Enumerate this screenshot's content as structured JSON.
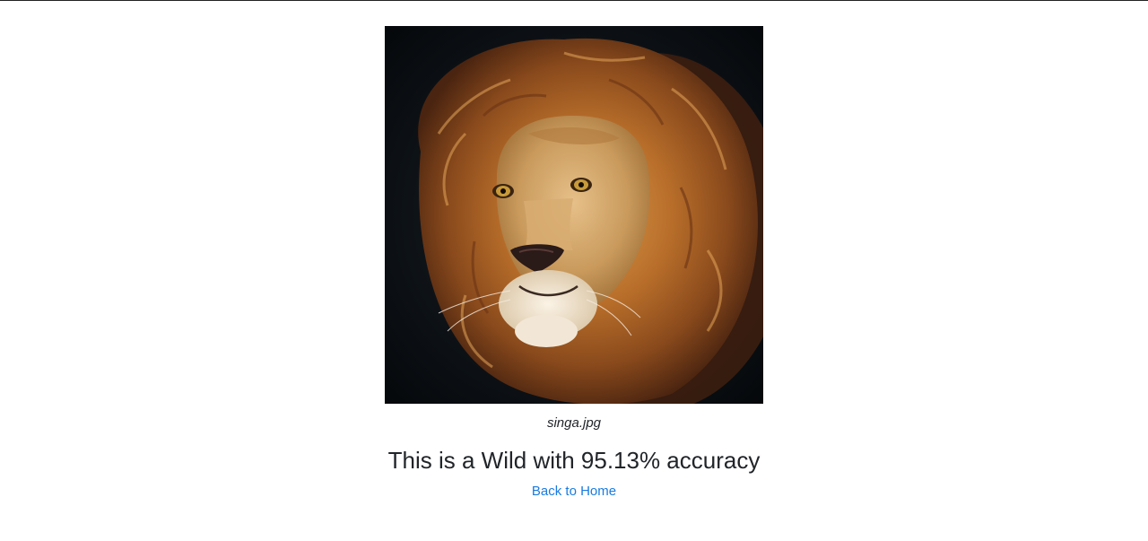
{
  "image": {
    "filename": "singa.jpg",
    "subject": "lion"
  },
  "result": {
    "text": "This is a Wild with 95.13% accuracy"
  },
  "nav": {
    "back_label": "Back to Home"
  },
  "colors": {
    "text": "#212529",
    "link": "#1a7be0",
    "background": "#ffffff"
  }
}
